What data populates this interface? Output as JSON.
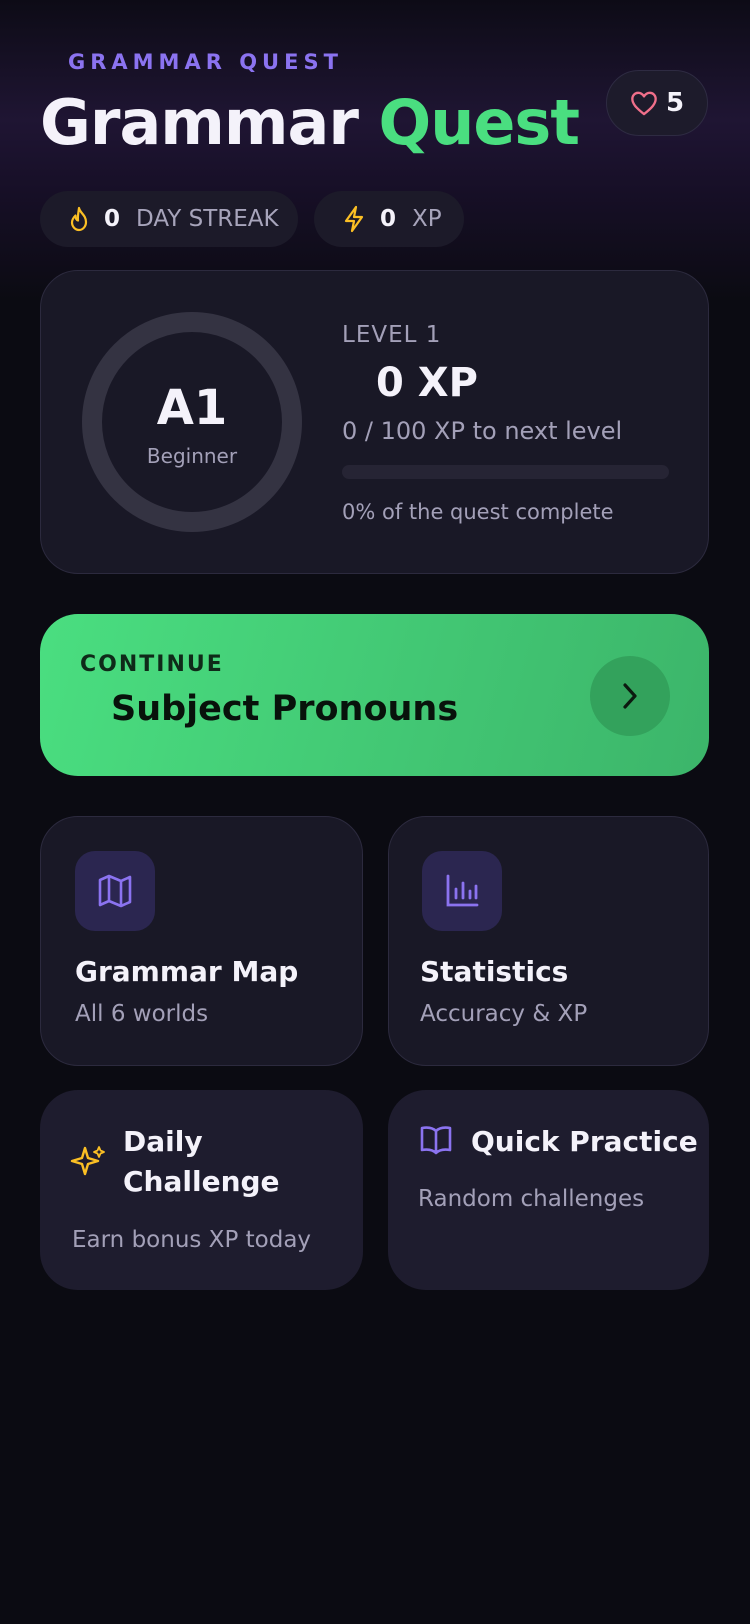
{
  "header": {
    "eyebrow": "GRAMMAR QUEST",
    "title_main": "Grammar",
    "title_accent": "Quest",
    "lives": "5"
  },
  "stats": {
    "streak_value": "0",
    "streak_label": "DAY STREAK",
    "xp_value": "0",
    "xp_label": "XP"
  },
  "level": {
    "code": "A1",
    "name": "Beginner",
    "label": "LEVEL 1",
    "xp": "0 XP",
    "next": "0 / 100 XP to next level",
    "progress": 0,
    "complete": "0% of the quest complete"
  },
  "continue": {
    "label": "CONTINUE",
    "lesson": "Subject Pronouns"
  },
  "tiles": {
    "map_title": "Grammar Map",
    "map_sub": "All 6 worlds",
    "stats_title": "Statistics",
    "stats_sub": "Accuracy & XP",
    "daily_title_1": "Daily",
    "daily_title_2": "Challenge",
    "daily_sub": "Earn bonus XP today",
    "quick_title": "Quick Practice",
    "quick_sub": "Random challenges"
  },
  "colors": {
    "accent_green": "#4ade80",
    "accent_purple": "#8b73f0",
    "heart": "#f06f8a",
    "gold": "#fbbf24"
  },
  "icons": [
    "heart-icon",
    "flame-icon",
    "lightning-icon",
    "chevron-right-icon",
    "map-icon",
    "bar-chart-icon",
    "sparkle-icon",
    "book-open-icon"
  ]
}
